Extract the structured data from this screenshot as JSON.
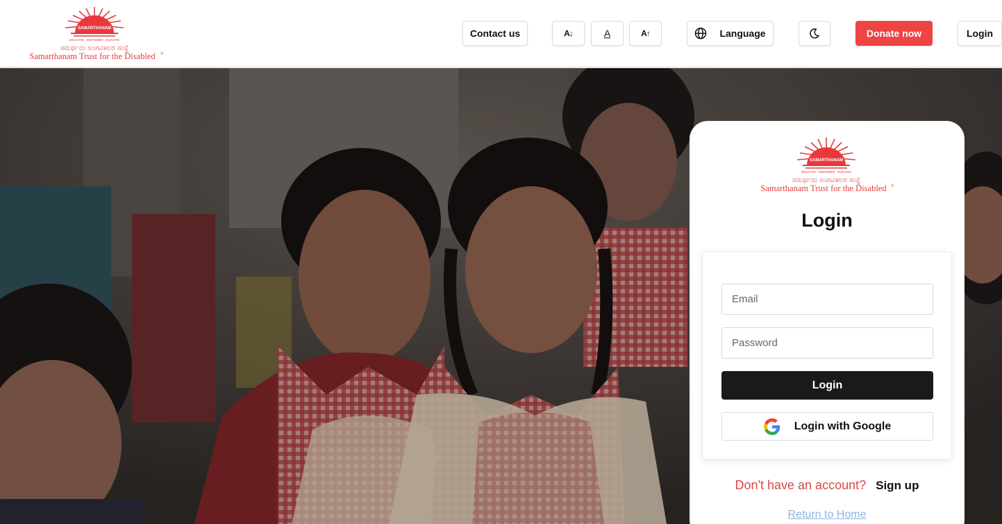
{
  "brand": {
    "arc_text": "SAMARTHANAM",
    "tagline": "EDUCATE . EMPOWER . ELEVATE",
    "kannada": "ಸಮರ್ಥನಂ ಅಂಗವಿಕಲರ ಸಂಸ್ಥೆ",
    "english": "Samarthanam Trust for the Disabled",
    "registered": "®"
  },
  "header": {
    "contact_label": "Contact us",
    "font_decrease_label": "A↓",
    "font_normal_label": "A",
    "font_increase_label": "A↑",
    "language_label": "Language",
    "donate_label": "Donate now",
    "login_label": "Login"
  },
  "login": {
    "title": "Login",
    "email_placeholder": "Email",
    "password_placeholder": "Password",
    "submit_label": "Login",
    "google_label": "Login with Google",
    "signup_question": "Don't have an account?",
    "signup_link": "Sign up",
    "home_link": "Return to Home"
  },
  "colors": {
    "brand_red": "#e8383c",
    "donate": "#ef4444",
    "submit": "#1a1a1a",
    "link_blue": "#8fb3e0"
  }
}
